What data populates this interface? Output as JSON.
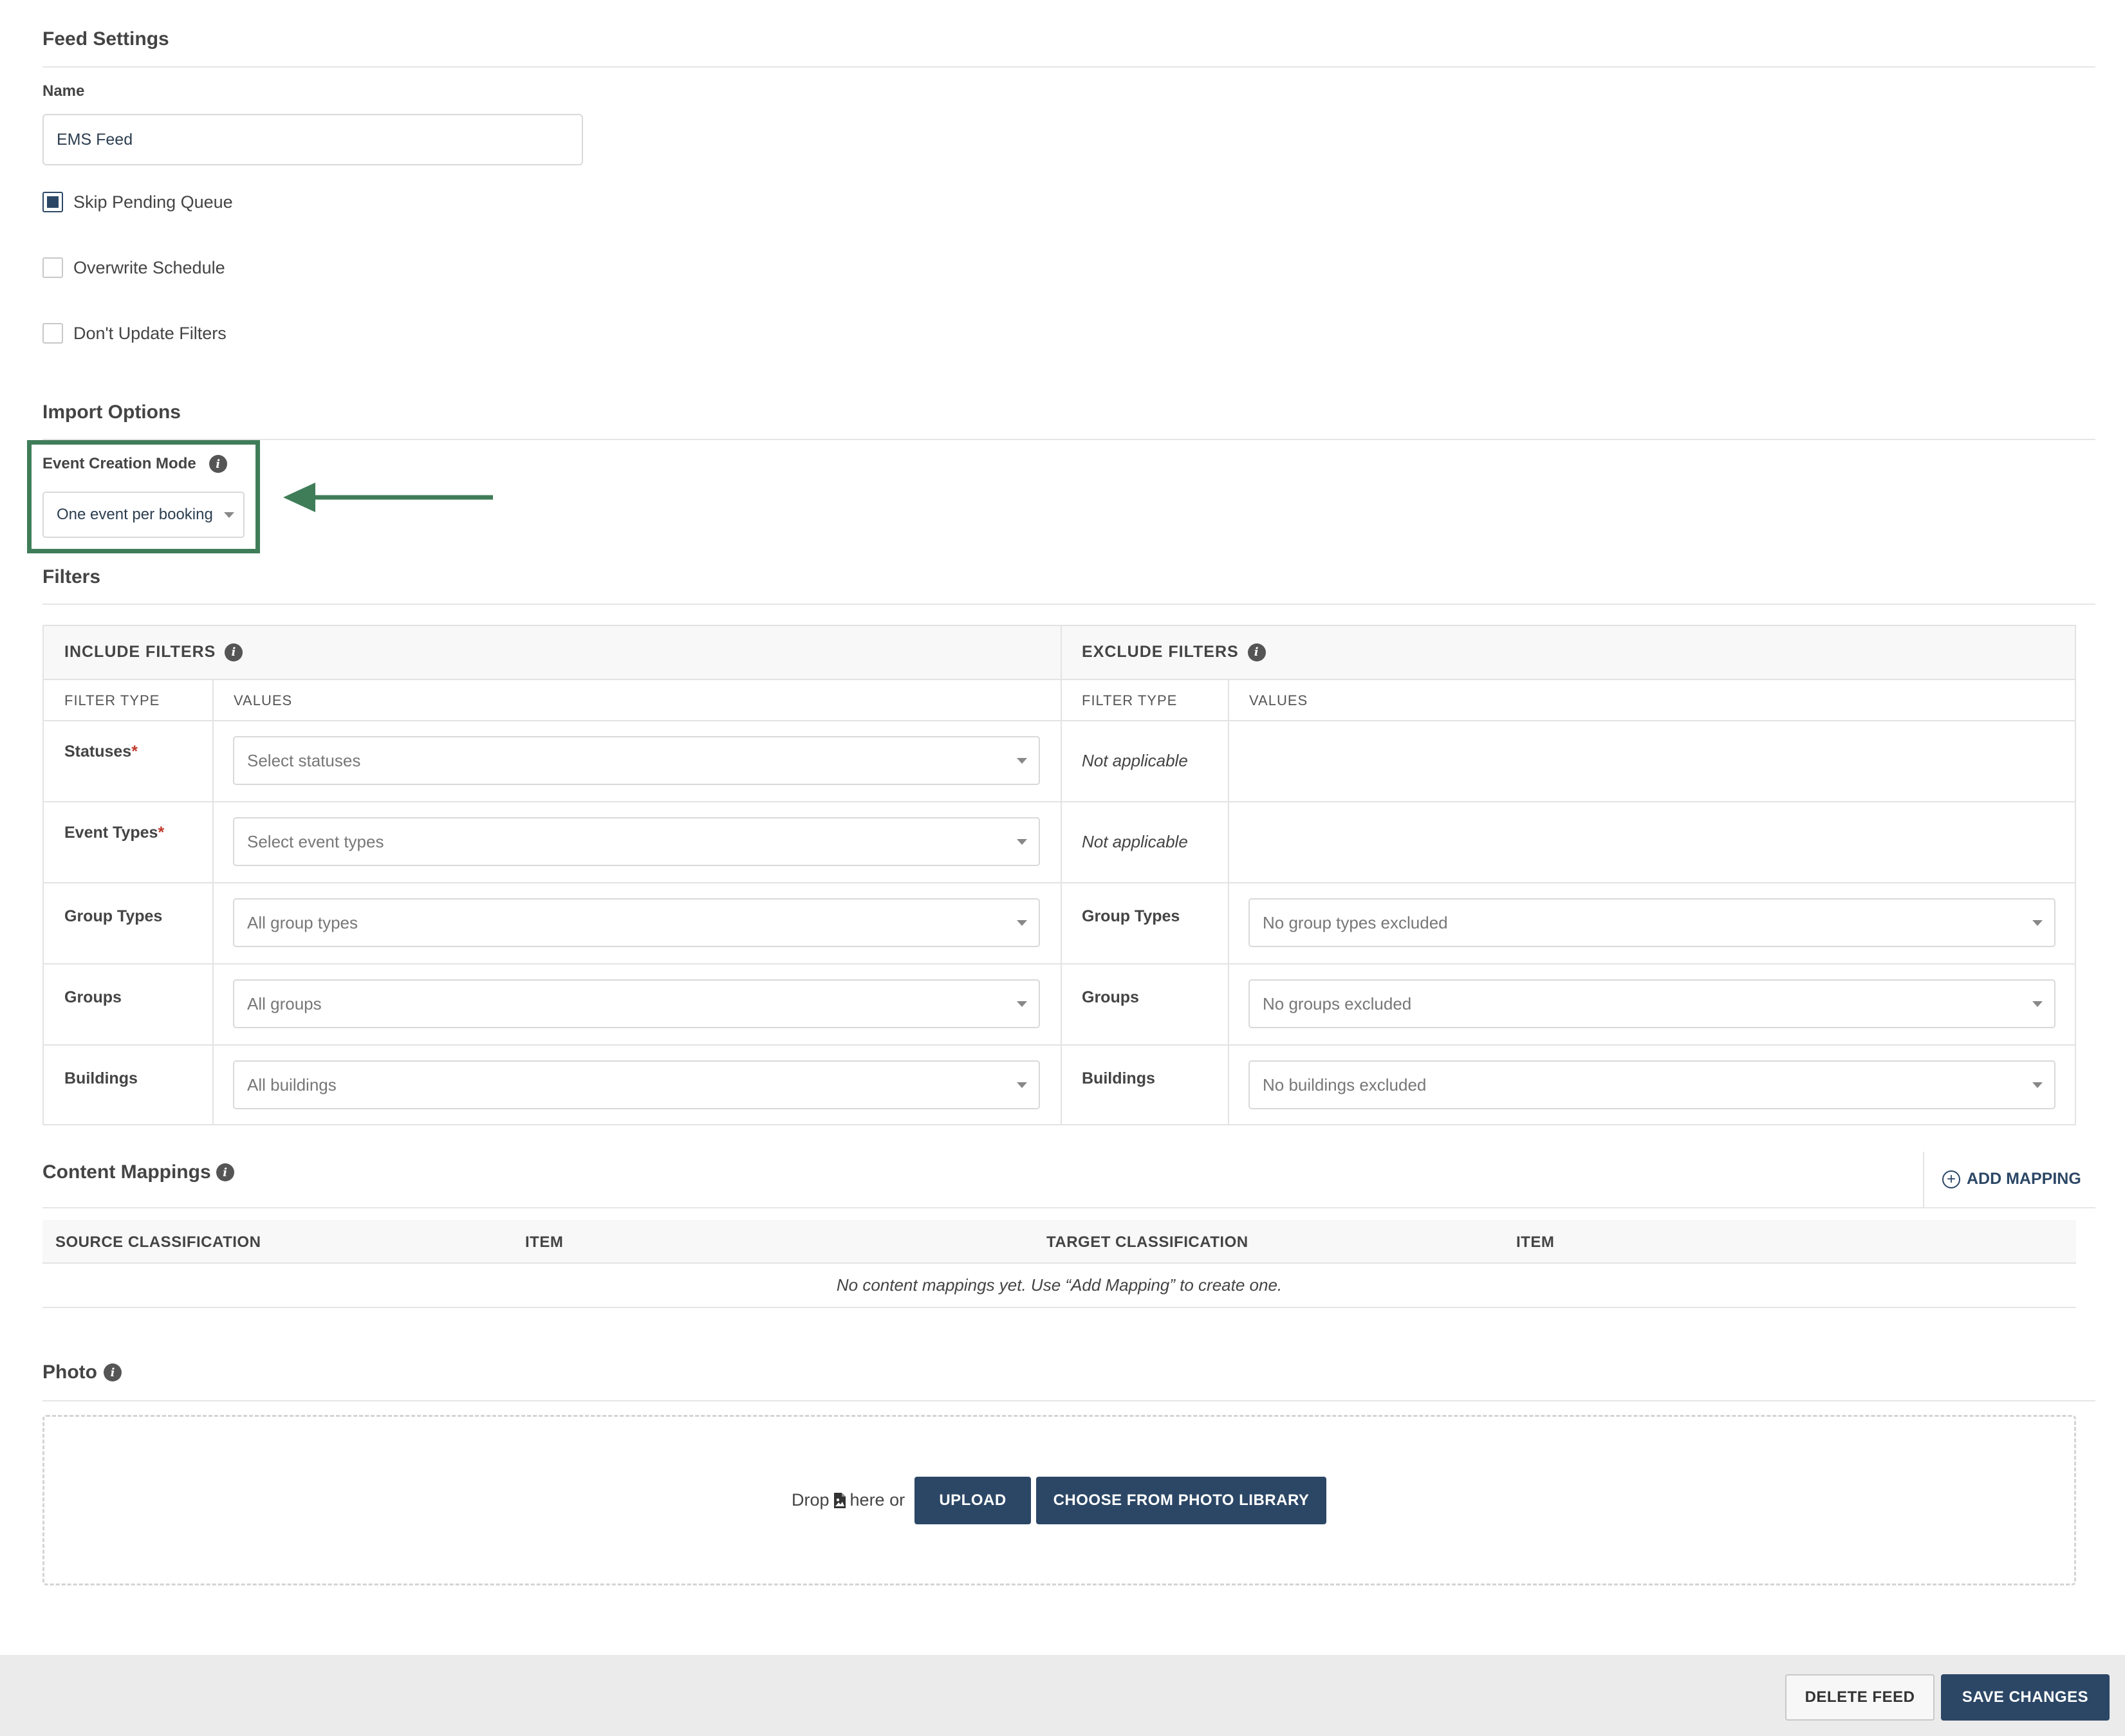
{
  "feed_settings": {
    "title": "Feed Settings",
    "name_label": "Name",
    "name_value": "EMS Feed",
    "checkboxes": [
      {
        "label": "Skip Pending Queue",
        "checked": true
      },
      {
        "label": "Overwrite Schedule",
        "checked": false
      },
      {
        "label": "Don't Update Filters",
        "checked": false
      }
    ]
  },
  "import_options": {
    "title": "Import Options",
    "event_creation_mode_label": "Event Creation Mode",
    "event_creation_mode_value": "One event per booking",
    "highlight_color": "#3f7d59"
  },
  "filters": {
    "title": "Filters",
    "include_header": "INCLUDE FILTERS",
    "exclude_header": "EXCLUDE FILTERS",
    "col_filter_type": "FILTER TYPE",
    "col_values": "VALUES",
    "rows": [
      {
        "label": "Statuses",
        "required": "*",
        "include_placeholder": "Select statuses",
        "exclude_text": "Not applicable"
      },
      {
        "label": "Event Types",
        "required": "*",
        "include_placeholder": "Select event types",
        "exclude_text": "Not applicable"
      },
      {
        "label": "Group Types",
        "include_placeholder": "All group types",
        "exclude_label": "Group Types",
        "exclude_placeholder": "No group types excluded"
      },
      {
        "label": "Groups",
        "include_placeholder": "All groups",
        "exclude_label": "Groups",
        "exclude_placeholder": "No groups excluded"
      },
      {
        "label": "Buildings",
        "include_placeholder": "All buildings",
        "exclude_label": "Buildings",
        "exclude_placeholder": "No buildings excluded"
      }
    ]
  },
  "content_mappings": {
    "title": "Content Mappings",
    "add_mapping": "ADD MAPPING",
    "columns": [
      "SOURCE CLASSIFICATION",
      "ITEM",
      "TARGET CLASSIFICATION",
      "ITEM"
    ],
    "empty_message": "No content mappings yet. Use “Add Mapping” to create one."
  },
  "photo": {
    "title": "Photo",
    "drop_prefix": "Drop",
    "drop_suffix": "here or",
    "upload_label": "UPLOAD",
    "library_label": "CHOOSE FROM PHOTO LIBRARY"
  },
  "footer": {
    "delete_label": "DELETE FEED",
    "save_label": "SAVE CHANGES"
  },
  "colors": {
    "primary": "#2c4766",
    "required": "#c0392b"
  }
}
